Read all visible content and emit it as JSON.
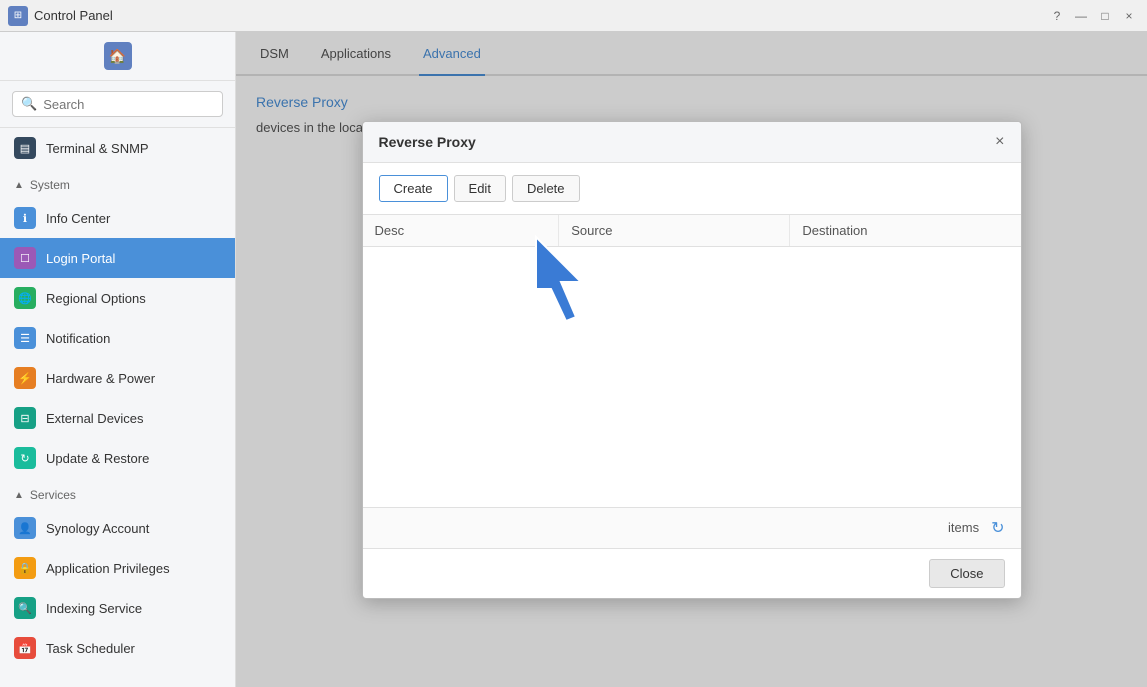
{
  "titlebar": {
    "title": "Control Panel",
    "icon": "⊞",
    "controls": [
      "?",
      "—",
      "□",
      "×"
    ]
  },
  "sidebar": {
    "search_placeholder": "Search",
    "home_label": "Home",
    "nav_items_top": [
      {
        "label": "Terminal & SNMP",
        "icon": "▤",
        "iconColor": "icon-dark"
      }
    ],
    "sections": [
      {
        "label": "System",
        "items": [
          {
            "label": "Info Center",
            "icon": "ℹ",
            "iconColor": "icon-blue",
            "id": "info-center"
          },
          {
            "label": "Login Portal",
            "icon": "☐",
            "iconColor": "icon-purple",
            "id": "login-portal",
            "active": true
          },
          {
            "label": "Regional Options",
            "icon": "🌐",
            "iconColor": "icon-green",
            "id": "regional-options"
          },
          {
            "label": "Notification",
            "icon": "☰",
            "iconColor": "icon-blue",
            "id": "notification"
          },
          {
            "label": "Hardware & Power",
            "icon": "⚡",
            "iconColor": "icon-orange",
            "id": "hardware-power"
          },
          {
            "label": "External Devices",
            "icon": "⊟",
            "iconColor": "icon-teal",
            "id": "external-devices"
          },
          {
            "label": "Update & Restore",
            "icon": "↻",
            "iconColor": "icon-cyan",
            "id": "update-restore"
          }
        ]
      },
      {
        "label": "Services",
        "items": [
          {
            "label": "Synology Account",
            "icon": "👤",
            "iconColor": "icon-blue",
            "id": "synology-account"
          },
          {
            "label": "Application Privileges",
            "icon": "🔒",
            "iconColor": "icon-yellow",
            "id": "app-privileges"
          },
          {
            "label": "Indexing Service",
            "icon": "🔍",
            "iconColor": "icon-teal",
            "id": "indexing-service"
          },
          {
            "label": "Task Scheduler",
            "icon": "📅",
            "iconColor": "icon-red",
            "id": "task-scheduler"
          }
        ]
      }
    ]
  },
  "tabs": {
    "items": [
      {
        "label": "DSM",
        "active": false
      },
      {
        "label": "Applications",
        "active": false
      },
      {
        "label": "Advanced",
        "active": true
      }
    ]
  },
  "content": {
    "breadcrumb": "Reverse Proxy",
    "description": "devices in the local network."
  },
  "modal": {
    "title": "Reverse Proxy",
    "close_label": "×",
    "toolbar": {
      "create_label": "Create",
      "edit_label": "Edit",
      "delete_label": "Delete"
    },
    "table": {
      "columns": [
        {
          "label": "Desc",
          "id": "desc"
        },
        {
          "label": "Source",
          "id": "source"
        },
        {
          "label": "Destination",
          "id": "destination"
        }
      ]
    },
    "footer": {
      "items_label": "items",
      "close_label": "Close"
    }
  }
}
